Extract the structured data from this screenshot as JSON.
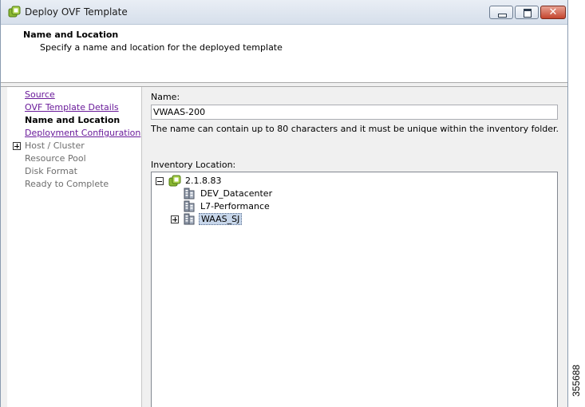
{
  "window": {
    "title": "Deploy OVF Template",
    "icon": "vsphere-icon",
    "controls": {
      "minimize": "minimize-icon",
      "maximize": "maximize-icon",
      "close": "✕"
    }
  },
  "header": {
    "title": "Name and Location",
    "subtitle": "Specify a name and location for the deployed template"
  },
  "sidebar": {
    "items": [
      {
        "label": "Source",
        "state": "link"
      },
      {
        "label": "OVF Template Details",
        "state": "link"
      },
      {
        "label": "Name and Location",
        "state": "current"
      },
      {
        "label": "Deployment Configuration",
        "state": "link"
      },
      {
        "label": "Host / Cluster",
        "state": "disabled",
        "expandable": true
      },
      {
        "label": "Resource Pool",
        "state": "disabled"
      },
      {
        "label": "Disk Format",
        "state": "disabled"
      },
      {
        "label": "Ready to Complete",
        "state": "disabled"
      }
    ]
  },
  "form": {
    "name_label": "Name:",
    "name_value": "VWAAS-200",
    "name_hint": "The name can contain up to 80 characters and it must be unique within the inventory folder.",
    "inventory_label": "Inventory Location:"
  },
  "tree": {
    "root": {
      "label": "2.1.8.83",
      "expanded": true
    },
    "children": [
      {
        "label": "DEV_Datacenter",
        "expandable": false,
        "selected": false
      },
      {
        "label": "L7-Performance",
        "expandable": false,
        "selected": false
      },
      {
        "label": "WAAS_SJ",
        "expandable": true,
        "selected": true
      }
    ]
  },
  "figure_number": "355688",
  "colors": {
    "link": "#6a1b9a",
    "selection": "#c7d6ea",
    "close_button": "#c4452e"
  }
}
